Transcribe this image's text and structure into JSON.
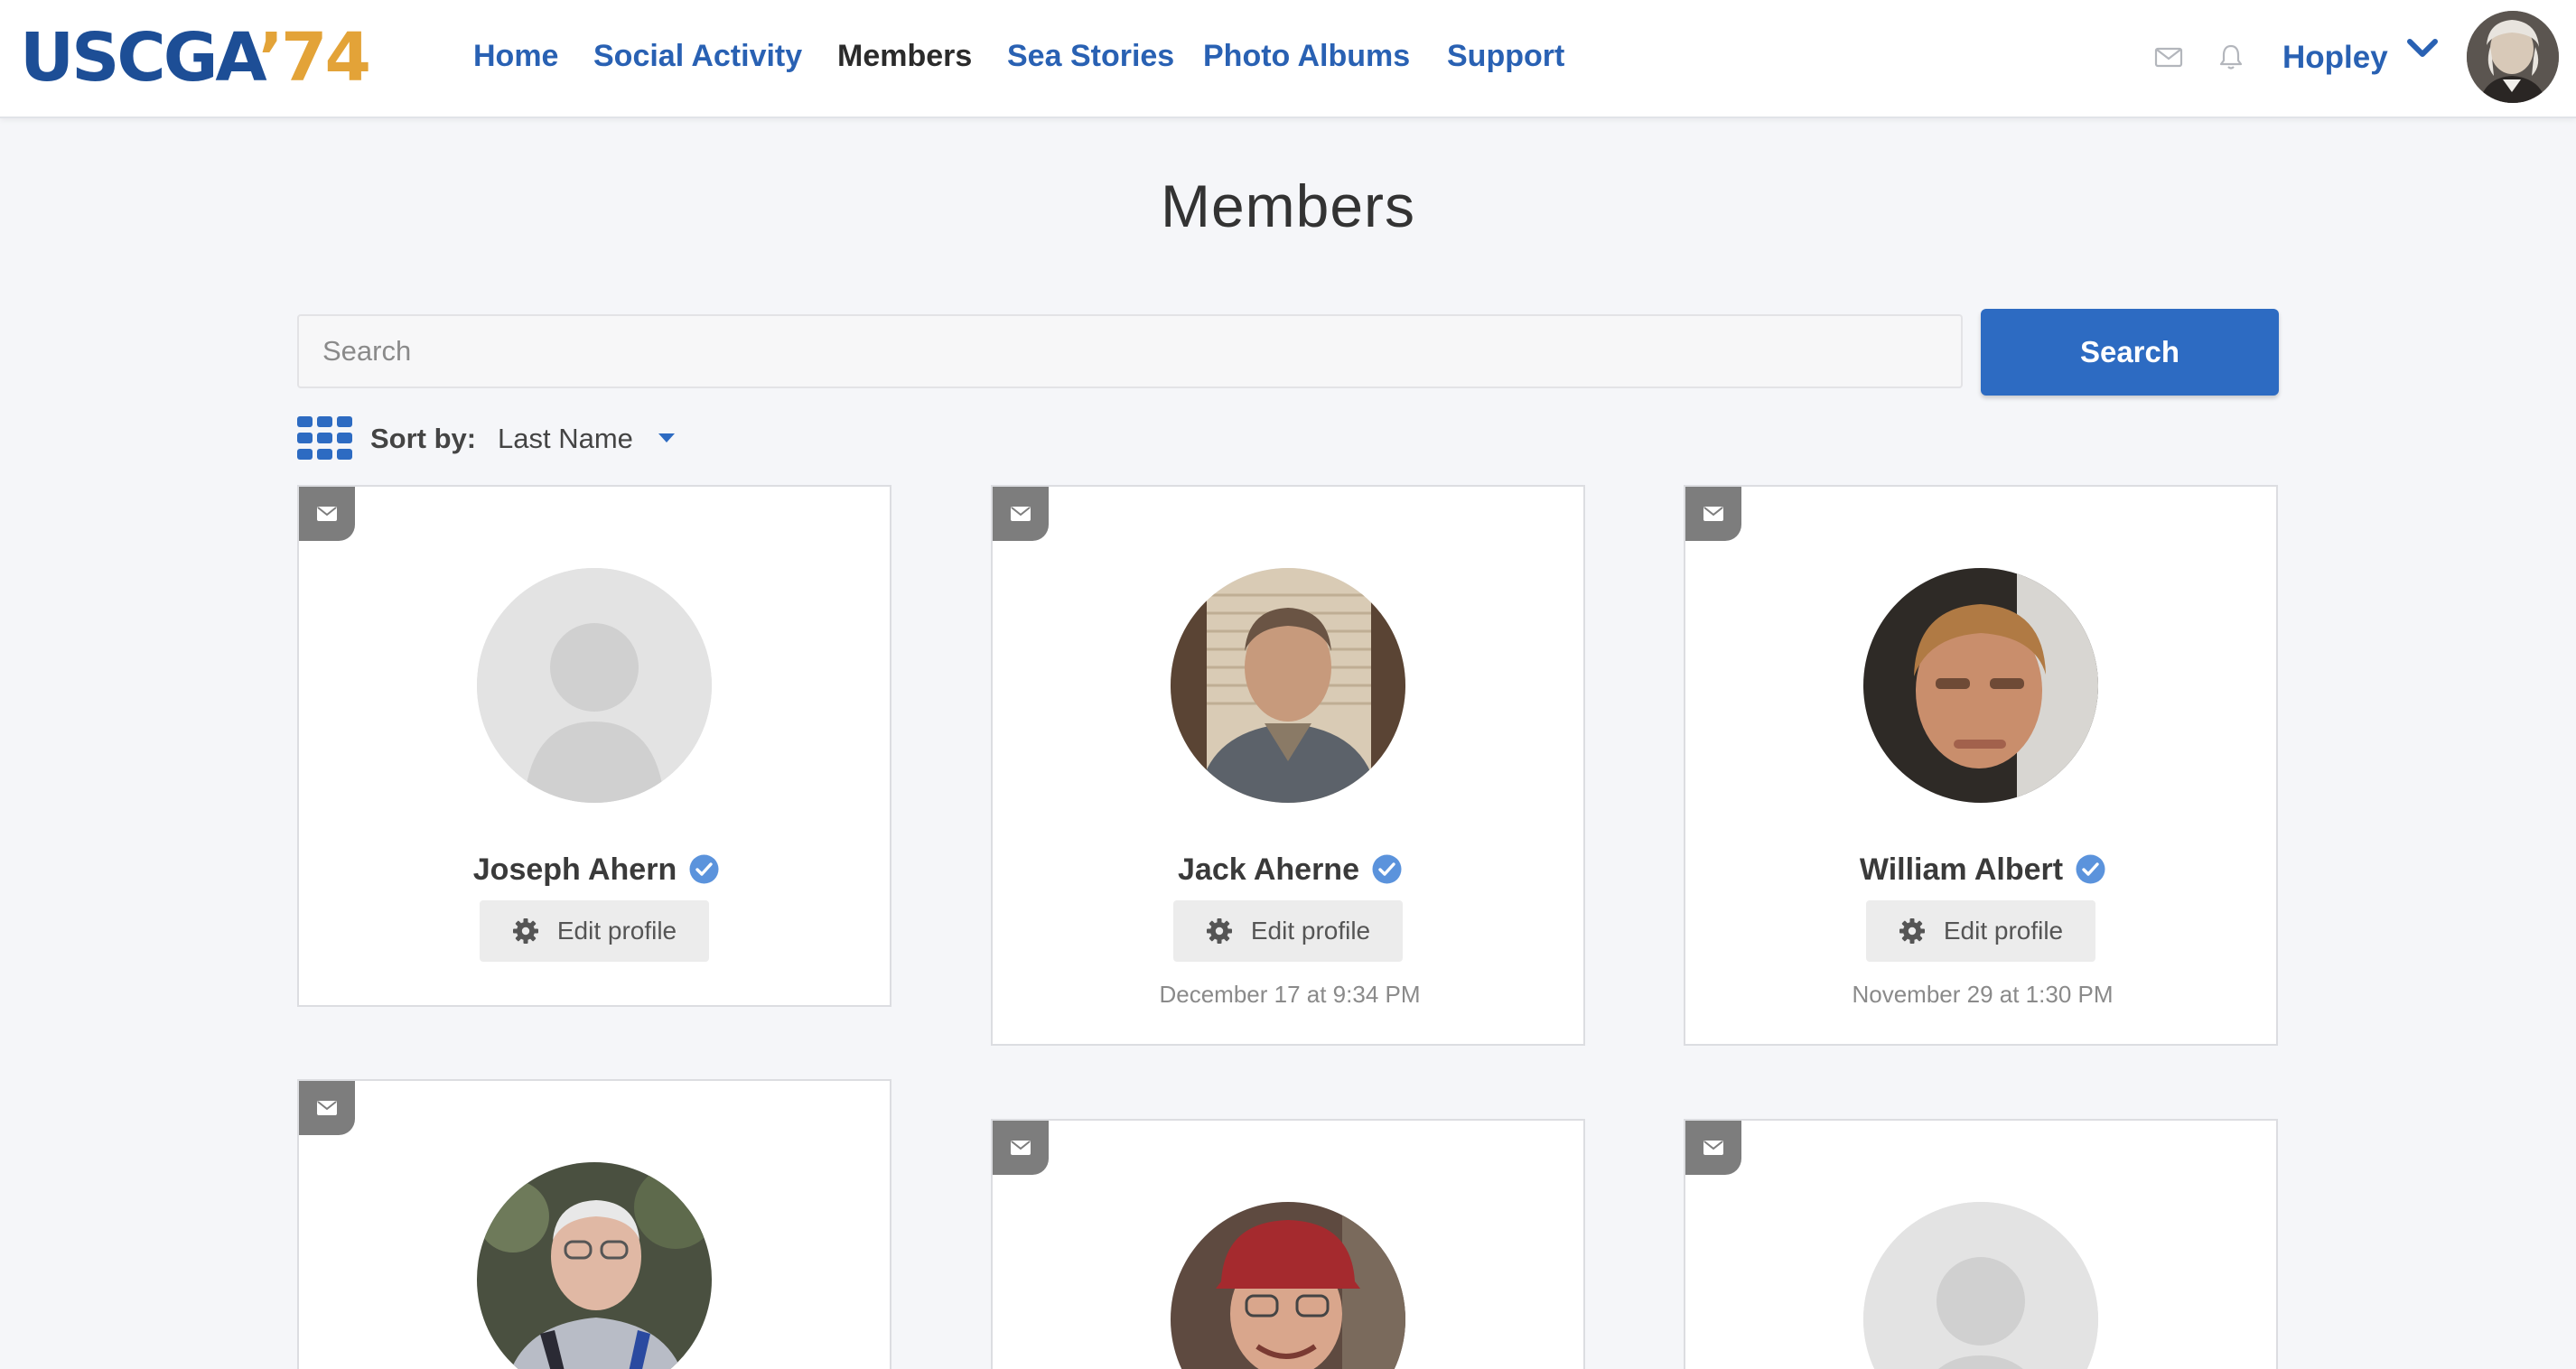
{
  "header": {
    "logo": {
      "part1": "USCGA",
      "part2": "’74"
    },
    "nav": [
      {
        "label": "Home"
      },
      {
        "label": "Social Activity"
      },
      {
        "label": "Members",
        "active": true
      },
      {
        "label": "Sea Stories"
      },
      {
        "label": "Photo Albums"
      },
      {
        "label": "Support"
      }
    ],
    "icons": [
      "mail-icon",
      "bell-icon",
      "chevron-down-icon"
    ],
    "user_name": "Hopley"
  },
  "page": {
    "title": "Members",
    "search": {
      "placeholder": "Search",
      "value": "",
      "button_label": "Search"
    },
    "sort": {
      "label": "Sort by:",
      "value": "Last Name"
    }
  },
  "members": [
    {
      "name": "Joseph Ahern",
      "verified": true,
      "edit_label": "Edit profile",
      "last_active": "",
      "avatar": "default-avatar"
    },
    {
      "name": "Jack Aherne",
      "verified": true,
      "edit_label": "Edit profile",
      "last_active": "December 17 at 9:34 PM",
      "avatar": "photo"
    },
    {
      "name": "William Albert",
      "verified": true,
      "edit_label": "Edit profile",
      "last_active": "November 29 at 1:30 PM",
      "avatar": "photo"
    },
    {
      "name": "",
      "avatar": "photo"
    },
    {
      "name": "",
      "avatar": "photo"
    },
    {
      "name": "",
      "avatar": "default-avatar"
    }
  ],
  "colors": {
    "brand_blue": "#1d4e96",
    "brand_gold": "#e3a338",
    "nav_blue": "#2961b3",
    "button_blue": "#2d6bc2",
    "verified_blue": "#5b93dc",
    "page_background": "#f5f6f9"
  }
}
